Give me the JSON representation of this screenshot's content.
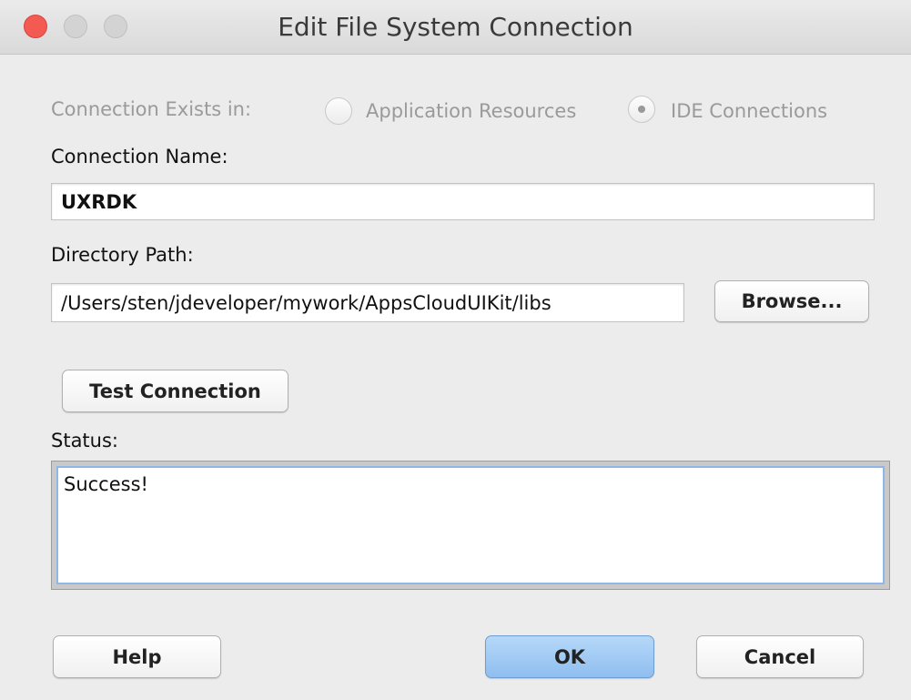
{
  "window": {
    "title": "Edit File System Connection"
  },
  "connection_exists": {
    "label": "Connection Exists in:",
    "options": [
      {
        "label": "Application Resources",
        "selected": false
      },
      {
        "label": "IDE Connections",
        "selected": true
      }
    ]
  },
  "connection_name": {
    "label": "Connection Name:",
    "value": "UXRDK"
  },
  "directory_path": {
    "label": "Directory Path:",
    "value": "/Users/sten/jdeveloper/mywork/AppsCloudUIKit/libs",
    "browse_label": "Browse..."
  },
  "test_connection": {
    "label": "Test Connection"
  },
  "status": {
    "label": "Status:",
    "value": "Success!"
  },
  "footer": {
    "help_label": "Help",
    "ok_label": "OK",
    "cancel_label": "Cancel"
  },
  "colors": {
    "close": "#f25a52",
    "primary_button": "#a4cbf4",
    "focus_ring": "#8fb6e6"
  }
}
